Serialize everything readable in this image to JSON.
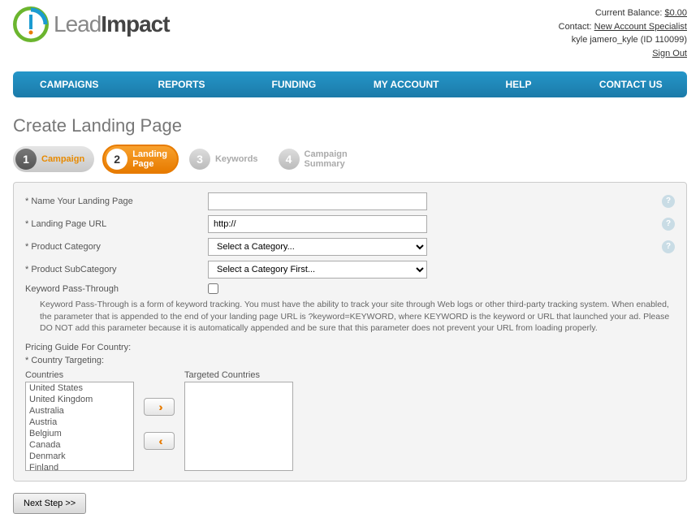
{
  "header": {
    "logo_a": "Lead",
    "logo_b": "Impact",
    "balance_label": "Current Balance: ",
    "balance_value": "$0.00",
    "contact_label": "Contact: ",
    "contact_link": "New Account Specialist",
    "user_line": "kyle jamero_kyle (ID 110099)",
    "signout": "Sign Out"
  },
  "nav": {
    "campaigns": "CAMPAIGNS",
    "reports": "REPORTS",
    "funding": "FUNDING",
    "myaccount": "MY ACCOUNT",
    "help": "HELP",
    "contactus": "CONTACT US"
  },
  "page_title": "Create Landing Page",
  "steps": {
    "s1_num": "1",
    "s1_label": "Campaign",
    "s2_num": "2",
    "s2_label_a": "Landing",
    "s2_label_b": "Page",
    "s3_num": "3",
    "s3_label": "Keywords",
    "s4_num": "4",
    "s4_label_a": "Campaign",
    "s4_label_b": "Summary"
  },
  "form": {
    "name_label": "* Name Your Landing Page",
    "name_value": "",
    "url_label": "* Landing Page URL",
    "url_value": "http://",
    "cat_label": "* Product Category",
    "cat_option": "Select a Category...",
    "subcat_label": "* Product SubCategory",
    "subcat_option": "Select a Category First...",
    "passthrough_label": "Keyword Pass-Through",
    "passthrough_help": "Keyword Pass-Through is a form of keyword tracking. You must have the ability to track your site through Web logs or other third-party tracking system. When enabled, the parameter that is appended to the end of your landing page URL is ?keyword=KEYWORD, where KEYWORD is the keyword or URL that launched your ad. Please DO NOT add this parameter because it is automatically appended and be sure that this parameter does not prevent your URL from loading properly.",
    "pricing_label": "Pricing Guide For Country:",
    "targeting_label": "* Country Targeting:",
    "countries_label": "Countries",
    "targeted_label": "Targeted Countries",
    "countries": [
      "United States",
      "United Kingdom",
      "Australia",
      "Austria",
      "Belgium",
      "Canada",
      "Denmark",
      "Finland"
    ]
  },
  "next_btn": "Next Step >>"
}
